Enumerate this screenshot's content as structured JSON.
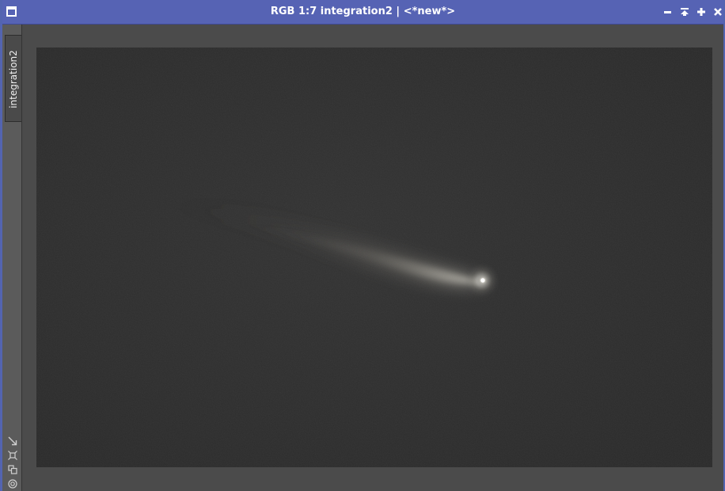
{
  "window": {
    "title": "RGB 1:7 integration2 | <*new*>",
    "title_bar_color": "#5663b4",
    "icons": {
      "window_menu": "window-icon",
      "minimize": "minimize-icon",
      "shade": "shade-icon",
      "maximize": "maximize-icon",
      "close": "close-icon"
    }
  },
  "side_tab": {
    "label": "integration2"
  },
  "side_tools": [
    "zoom-fit-icon",
    "fit-view-icon",
    "clone-icon",
    "target-icon"
  ],
  "image": {
    "description_icon": "comet-image",
    "background_color": "#2d2d2d"
  }
}
